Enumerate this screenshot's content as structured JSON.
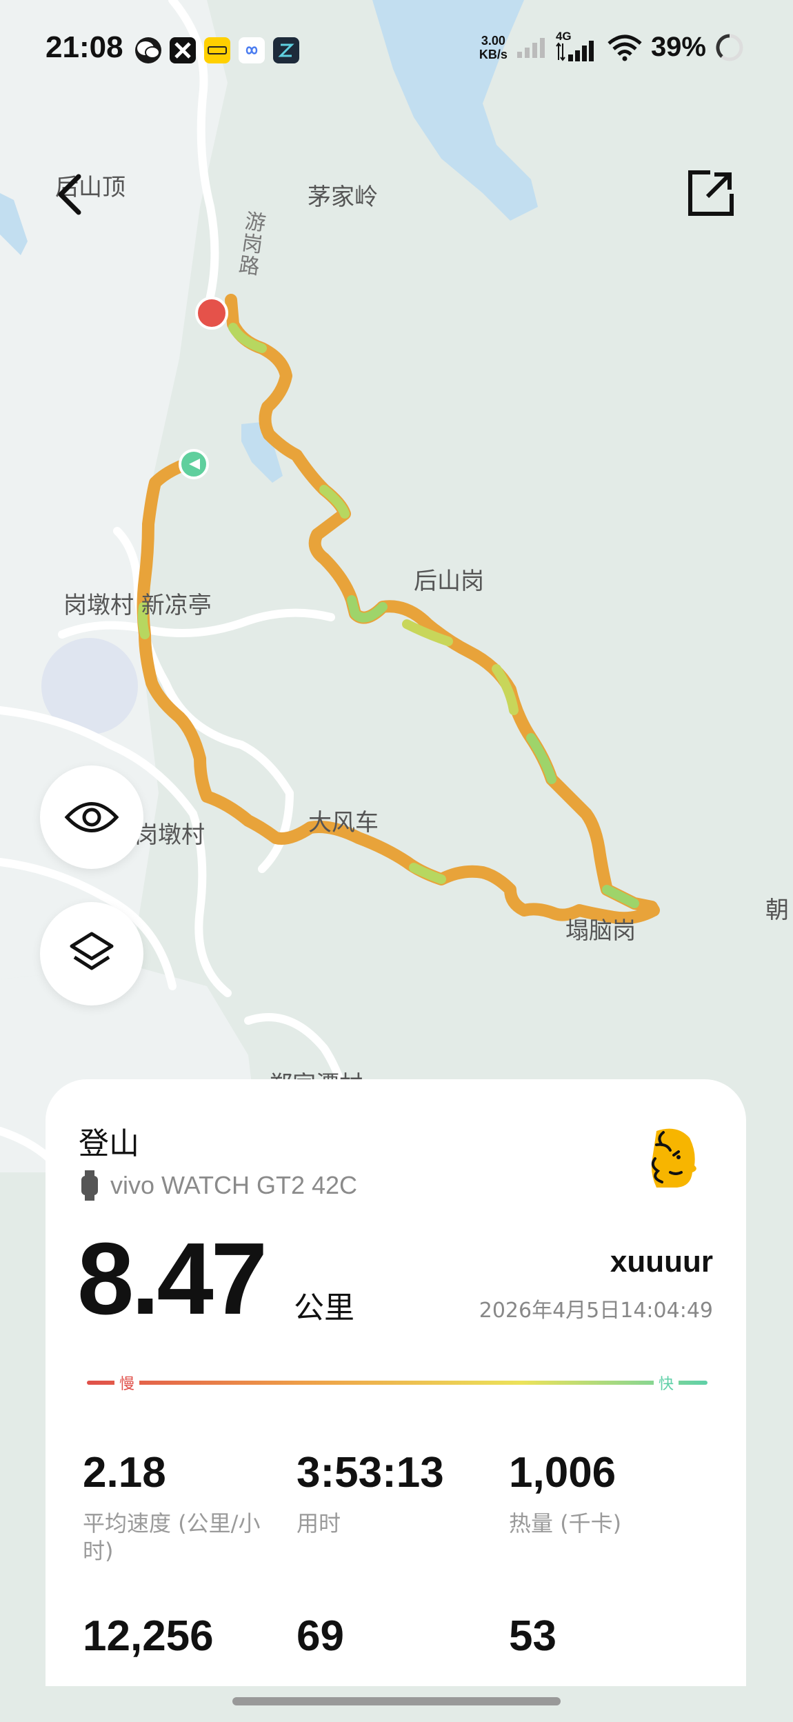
{
  "status_bar": {
    "time": "21:08",
    "net_speed_value": "3.00",
    "net_speed_unit": "KB/s",
    "network_type": "4G",
    "battery": "39%"
  },
  "map": {
    "labels": {
      "houshanding": "后山顶",
      "maojialing": "茅家岭",
      "road": "游岗路",
      "houshangang": "后山岗",
      "gangdun_xinliang": "岗墩村 新凉亭",
      "gangdun": "岗墩村",
      "dafengche": "大风车",
      "tagang": "塌脑岗",
      "chao": "朝",
      "bottom_village": "郑家潭村"
    }
  },
  "activity": {
    "sport": "登山",
    "device": "vivo WATCH GT2 42C",
    "distance": "8.47",
    "distance_unit": "公里",
    "username": "xuuuur",
    "datetime": "2026年4月5日14:04:49",
    "speed_slow_label": "慢",
    "speed_fast_label": "快",
    "stats": [
      {
        "value": "2.18",
        "label": "平均速度 (公里/小时)"
      },
      {
        "value": "3:53:13",
        "label": "用时"
      },
      {
        "value": "1,006",
        "label": "热量 (千卡)"
      },
      {
        "value": "12,256",
        "label": ""
      },
      {
        "value": "69",
        "label": ""
      },
      {
        "value": "53",
        "label": ""
      }
    ]
  },
  "colors": {
    "route_slow": "#e8a33a",
    "route_fast": "#9ed46a",
    "start_marker": "#5fcf9d",
    "end_marker": "#e5524a",
    "water": "#c2def0",
    "accent_fast": "#5fd0a8",
    "accent_slow": "#e0504a"
  }
}
